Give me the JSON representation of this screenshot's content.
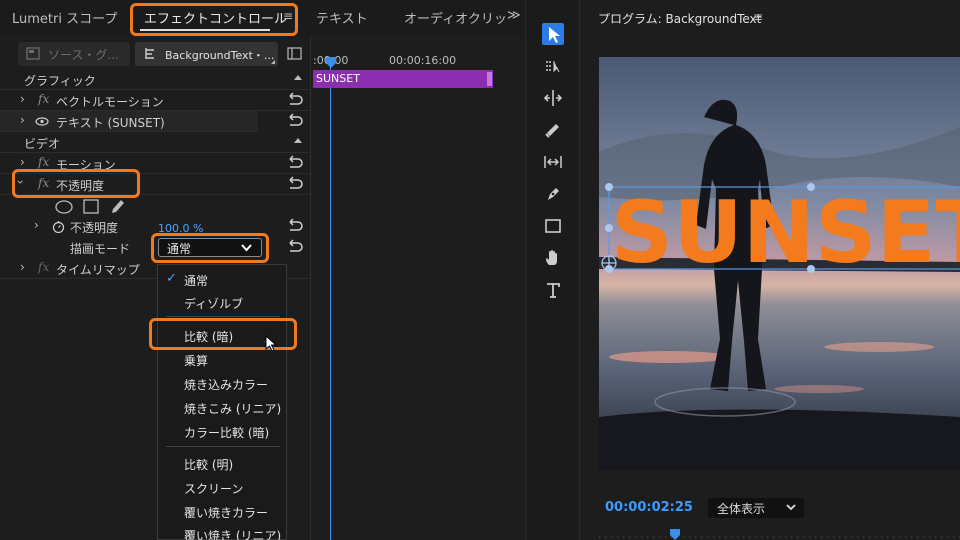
{
  "tabs": {
    "lumetri": "Lumetri スコープ",
    "effect_controls": "エフェクトコントロール",
    "text": "テキスト",
    "audio": "オーディオクリッ",
    "more": "≫",
    "menu_glyph": "≡"
  },
  "effect_controls": {
    "source_label": "ソース・グ...",
    "sequence_label": "BackgroundText・...",
    "sections": {
      "graphic": "グラフィック",
      "video": "ビデオ"
    },
    "rows": {
      "vector_motion": "ベクトルモーション",
      "text_layer": "テキスト (SUNSET)",
      "motion": "モーション",
      "opacity": "不透明度",
      "opacity_param": "不透明度",
      "opacity_value": "100.0 %",
      "blend_mode_label": "描画モード",
      "blend_mode_value": "通常",
      "time_remap": "タイムリマップ"
    }
  },
  "timeline": {
    "tc_start": ":00:00",
    "tc_end": "00:00:16:00",
    "clip_name": "SUNSET"
  },
  "blend_menu": {
    "items": [
      "通常",
      "ディゾルブ",
      "比較 (暗)",
      "乗算",
      "焼き込みカラー",
      "焼きこみ (リニア)",
      "カラー比較 (暗)",
      "比較 (明)",
      "スクリーン",
      "覆い焼きカラー",
      "覆い焼き (リニア)"
    ],
    "checkmark": "✓"
  },
  "program": {
    "title": "プログラム: BackgroundText",
    "menu_glyph": "≡",
    "overlay_text": "SUNSET",
    "timecode": "00:00:02:25",
    "fit": "全体表示"
  },
  "colors": {
    "accent_orange": "#f07a1f",
    "clip_purple": "#8b2fb0",
    "timecode_blue": "#3b9bff",
    "overlay_text": "#f47a1e"
  }
}
